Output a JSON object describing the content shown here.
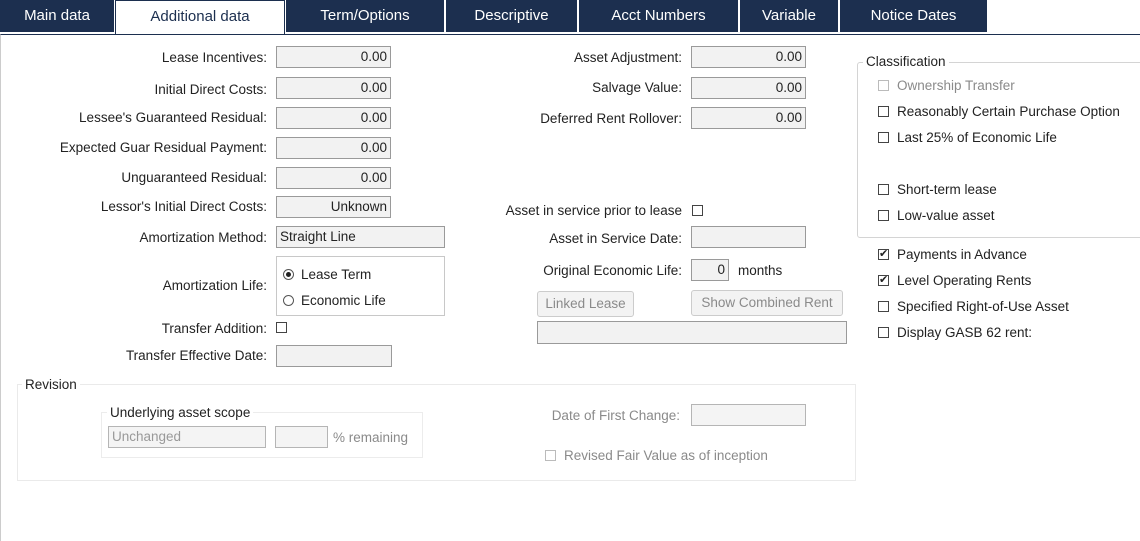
{
  "tabs": [
    "Main data",
    "Additional data",
    "Term/Options",
    "Descriptive",
    "Acct Numbers",
    "Variable",
    "Notice Dates"
  ],
  "left": {
    "lease_incentives": {
      "label": "Lease Incentives:",
      "value": "0.00"
    },
    "initial_direct_costs": {
      "label": "Initial Direct Costs:",
      "value": "0.00"
    },
    "lessee_guar_residual": {
      "label": "Lessee's Guaranteed Residual:",
      "value": "0.00"
    },
    "expected_guar_residual": {
      "label": "Expected Guar Residual Payment:",
      "value": "0.00"
    },
    "unguaranteed_residual": {
      "label": "Unguaranteed Residual:",
      "value": "0.00"
    },
    "lessor_idc": {
      "label": "Lessor's Initial Direct Costs:",
      "value": "Unknown"
    },
    "amort_method": {
      "label": "Amortization Method:",
      "value": "Straight Line"
    },
    "amort_life": {
      "label": "Amortization Life:",
      "options": [
        "Lease Term",
        "Economic Life"
      ],
      "selected": "Lease Term"
    },
    "transfer_addition": {
      "label": "Transfer Addition:",
      "checked": false
    },
    "transfer_eff_date": {
      "label": "Transfer Effective Date:",
      "value": ""
    }
  },
  "middle": {
    "asset_adjustment": {
      "label": "Asset Adjustment:",
      "value": "0.00"
    },
    "salvage_value": {
      "label": "Salvage Value:",
      "value": "0.00"
    },
    "deferred_rent": {
      "label": "Deferred Rent Rollover:",
      "value": "0.00"
    },
    "asset_in_service_prior": {
      "label": "Asset in service prior to lease",
      "checked": false
    },
    "asset_in_service_date": {
      "label": "Asset in Service Date:",
      "value": ""
    },
    "orig_econ_life": {
      "label": "Original Economic Life:",
      "value": "0",
      "unit": "months"
    },
    "linked_lease_btn": "Linked Lease",
    "show_combined_rent_btn": "Show Combined Rent",
    "linked_lease_value": ""
  },
  "classification": {
    "title": "Classification",
    "items": [
      {
        "label": "Ownership Transfer",
        "checked": false,
        "disabled": true
      },
      {
        "label": "Reasonably Certain Purchase Option",
        "checked": false,
        "disabled": false
      },
      {
        "label": "Last 25% of Economic Life",
        "checked": false,
        "disabled": false
      },
      {
        "label": "Short-term lease",
        "checked": false,
        "disabled": false
      },
      {
        "label": "Low-value asset",
        "checked": false,
        "disabled": false
      }
    ]
  },
  "right_checks": [
    {
      "label": "Payments in Advance",
      "checked": true
    },
    {
      "label": "Level Operating Rents",
      "checked": true
    },
    {
      "label": "Specified Right-of-Use Asset",
      "checked": false
    },
    {
      "label": "Display GASB 62 rent:",
      "checked": false
    }
  ],
  "revision": {
    "title": "Revision",
    "scope_title": "Underlying asset scope",
    "scope_value": "Unchanged",
    "remaining_value": "",
    "remaining_label": "% remaining",
    "date_first_change_label": "Date of First Change:",
    "date_first_change_value": "",
    "revised_fv": {
      "label": "Revised Fair Value as of inception",
      "checked": false
    }
  },
  "check_mark": "✔"
}
